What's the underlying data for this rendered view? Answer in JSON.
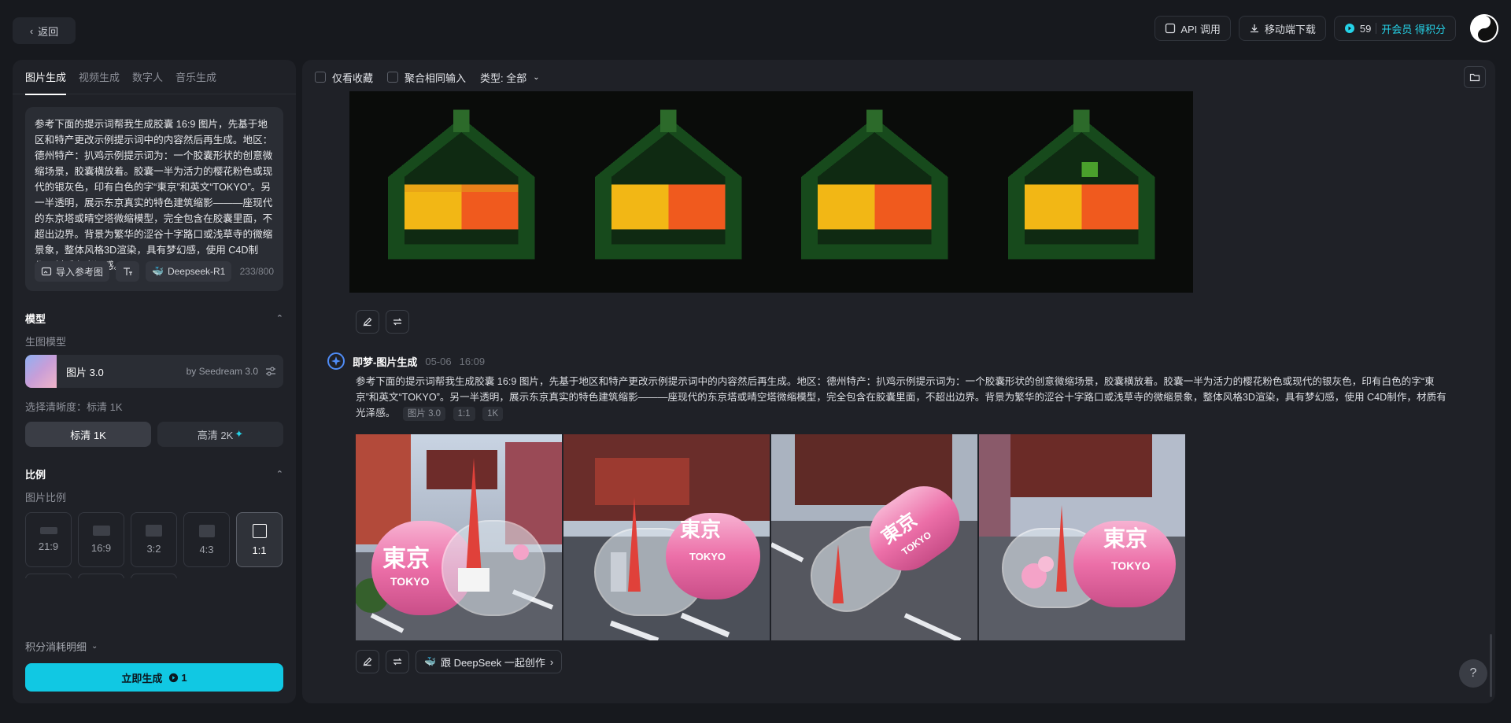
{
  "topbar": {
    "back_label": "返回",
    "api_label": "API 调用",
    "mobile_label": "移动端下载",
    "points": "59",
    "member_label": "开会员 得积分"
  },
  "left": {
    "tabs": [
      {
        "label": "图片生成",
        "active": true
      },
      {
        "label": "视频生成"
      },
      {
        "label": "数字人"
      },
      {
        "label": "音乐生成"
      }
    ],
    "prompt": "参考下面的提示词帮我生成胶囊 16:9 图片，先基于地区和特产更改示例提示词中的内容然后再生成。地区：德州特产：扒鸡示例提示词为：一个胶囊形状的创意微缩场景，胶囊横放着。胶囊一半为活力的樱花粉色或现代的银灰色，印有白色的字“東京”和英文“TOKYO”。另一半透明，展示东京真实的特色建筑缩影———座现代的东京塔或晴空塔微缩模型，完全包含在胶囊里面，不超出边界。背景为繁华的涩谷十字路口或浅草寺的微缩景象，整体风格3D渲染，具有梦幻感，使用 C4D制作，材质有光泽感。",
    "import_ref": "导入参考图",
    "deepseek_label": "Deepseek-R1",
    "char_count": "233/800",
    "model_section": "模型",
    "model_sub": "生图模型",
    "model_name": "图片 3.0",
    "model_by": "by Seedream 3.0",
    "clarity_label": "选择清晰度：标清 1K",
    "clarity_std": "标清 1K",
    "clarity_hd": "高清 2K",
    "ratio_section": "比例",
    "ratio_sub": "图片比例",
    "ratios": [
      "21:9",
      "16:9",
      "3:2",
      "4:3",
      "1:1"
    ],
    "cost_label": "积分消耗明细",
    "generate_label": "立即生成",
    "generate_cost": "1"
  },
  "main": {
    "filter_fav": "仅看收藏",
    "filter_merge": "聚合相同输入",
    "filter_type": "类型: 全部",
    "gen_title": "即梦-图片生成",
    "gen_date": "05-06",
    "gen_time": "16:09",
    "gen_prompt": "参考下面的提示词帮我生成胶囊 16:9 图片，先基于地区和特产更改示例提示词中的内容然后再生成。地区：德州特产：扒鸡示例提示词为：一个胶囊形状的创意微缩场景，胶囊横放着。胶囊一半为活力的樱花粉色或现代的银灰色，印有白色的字“東京”和英文“TOKYO”。另一半透明，展示东京真实的特色建筑缩影———座现代的东京塔或晴空塔微缩模型，完全包含在胶囊里面，不超出边界。背景为繁华的涩谷十字路口或浅草寺的微缩景象，整体风格3D渲染，具有梦幻感，使用 C4D制作，材质有光泽感。",
    "tags": [
      "图片 3.0",
      "1:1",
      "1K"
    ],
    "deepseek_create": "跟 DeepSeek 一起创作",
    "capsule_cn": "東京",
    "capsule_en": "TOKYO",
    "help": "?"
  },
  "colors": {
    "accent": "#11c8e3",
    "bg": "#17191e",
    "panel": "#1f2127",
    "pink": "#ef7fb3"
  }
}
